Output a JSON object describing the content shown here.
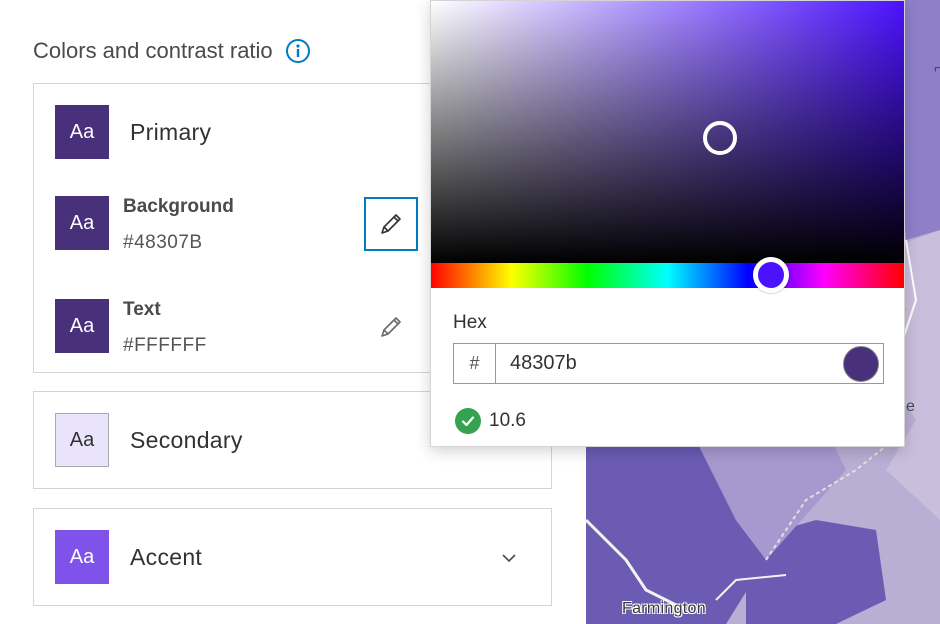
{
  "panel": {
    "title": "Colors and contrast ratio"
  },
  "groups": {
    "primary": {
      "swatch_text": "Aa",
      "name": "Primary",
      "color": "#48307B",
      "rows": [
        {
          "label": "Background",
          "hex": "#48307B",
          "swatch_text": "Aa",
          "swatch_color": "#48307B"
        },
        {
          "label": "Text",
          "hex": "#FFFFFF",
          "swatch_text": "Aa",
          "swatch_color": "#48307B"
        }
      ]
    },
    "secondary": {
      "swatch_text": "Aa",
      "name": "Secondary",
      "color": "#E9E3FB"
    },
    "accent": {
      "swatch_text": "Aa",
      "name": "Accent",
      "color": "#7F52EA"
    }
  },
  "picker": {
    "hex_label": "Hex",
    "hex_prefix": "#",
    "hex_value": "48307b",
    "preview_color": "#48307B",
    "contrast_value": "10.6",
    "contrast_status_color": "#35A24F",
    "hue_color": "#4B12FF"
  },
  "map": {
    "place_label": "Farmington"
  },
  "icons": {
    "info": "info-icon",
    "edit": "pencil-icon",
    "chevron": "chevron-down-icon",
    "check": "check-circle-icon"
  }
}
